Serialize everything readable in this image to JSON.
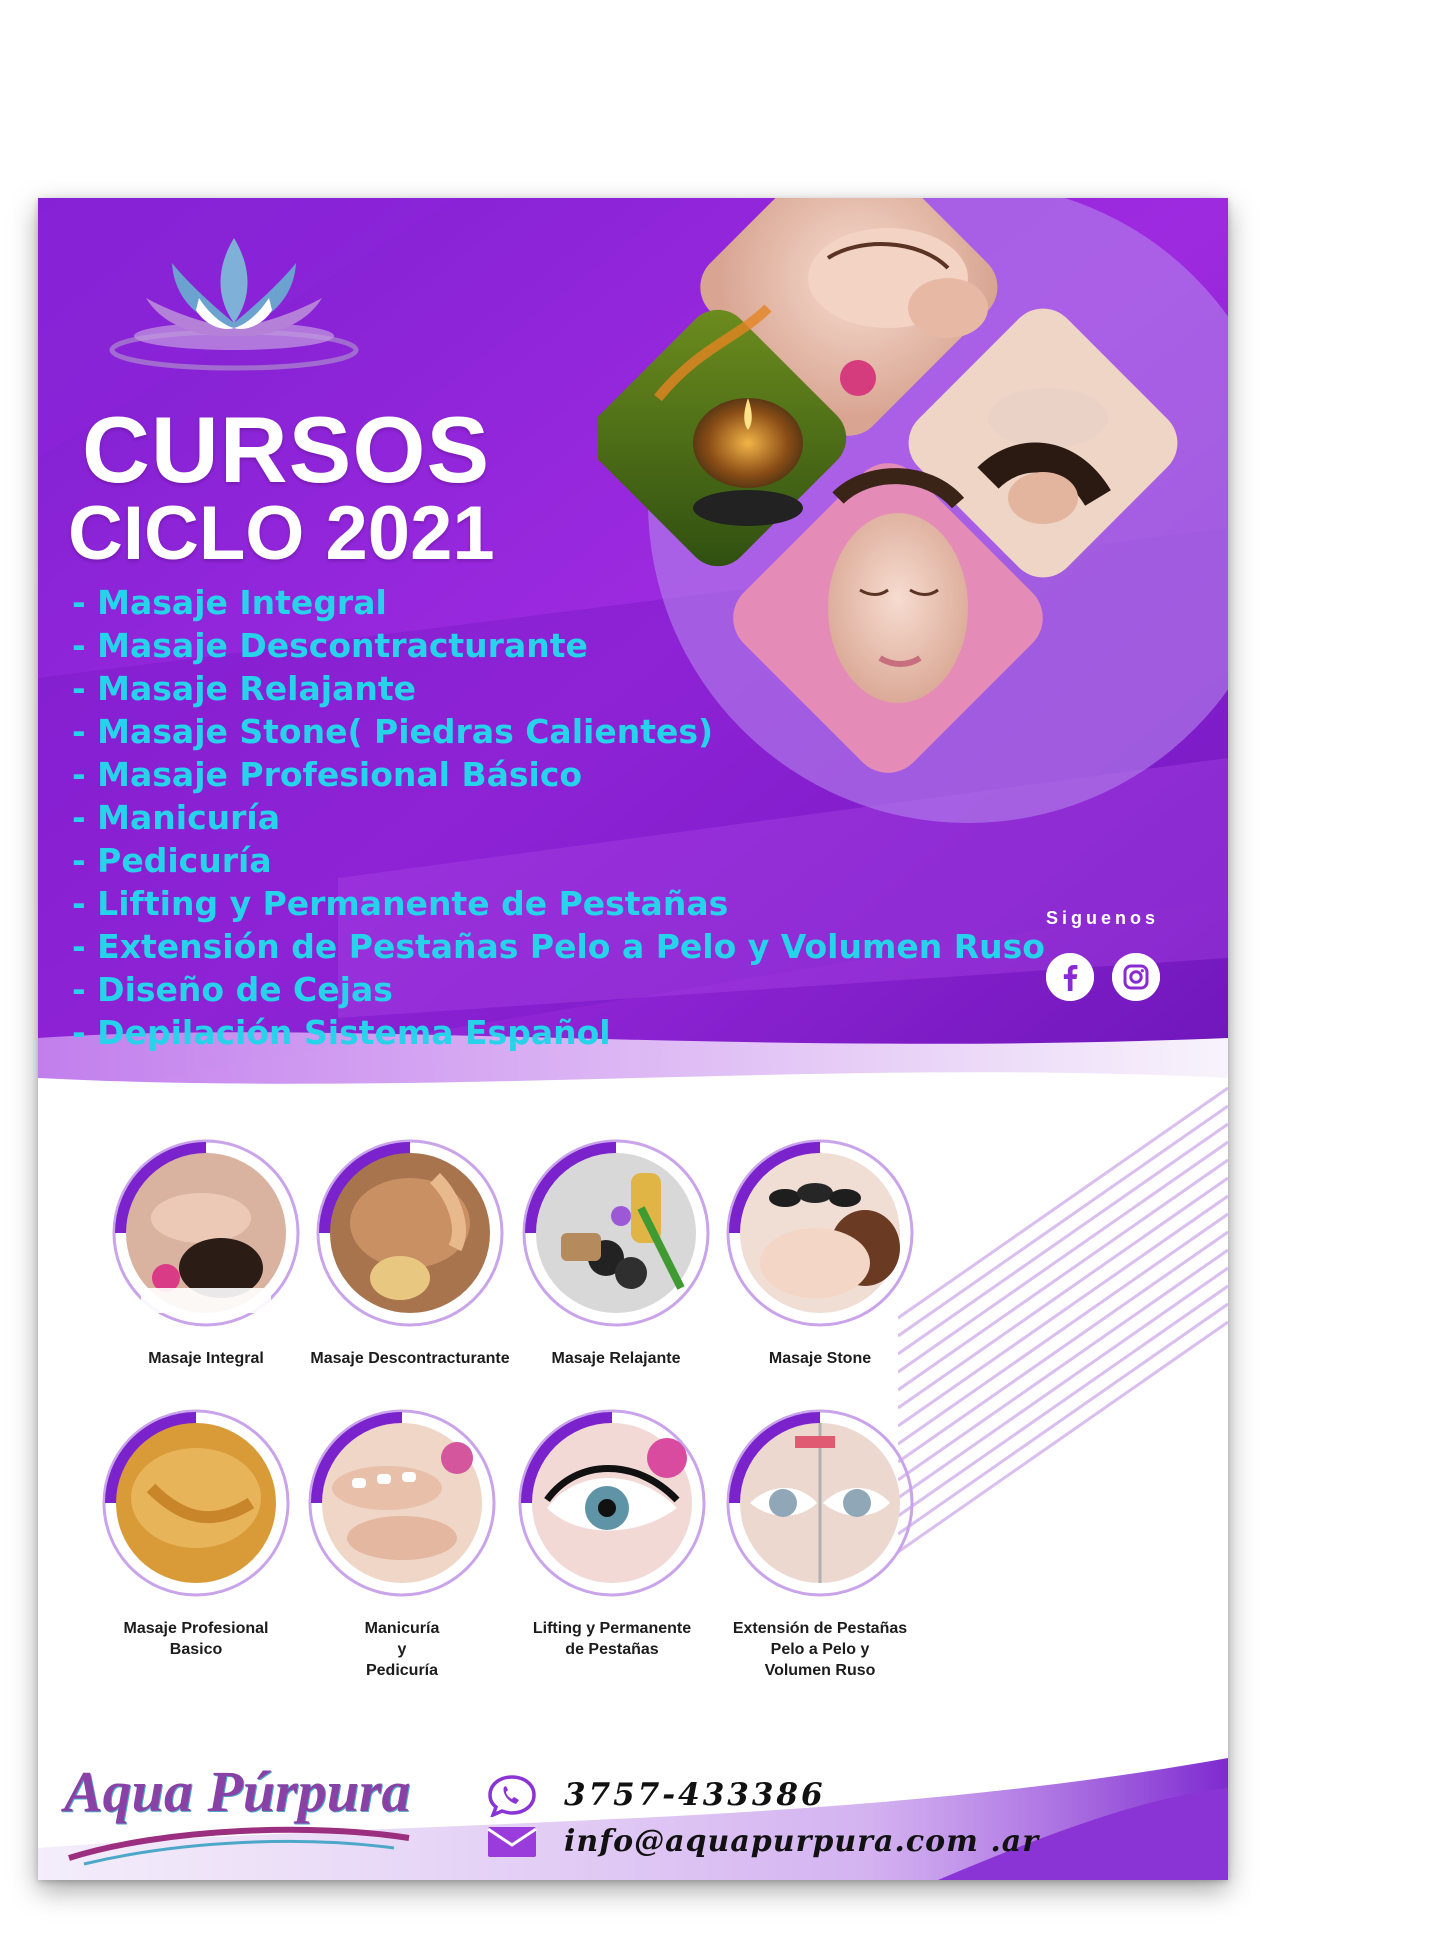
{
  "header": {
    "title": "CURSOS",
    "subtitle": "CICLO 2021"
  },
  "courses": [
    "- Masaje Integral",
    "- Masaje Descontracturante",
    "- Masaje Relajante",
    "- Masaje Stone( Piedras Calientes)",
    "- Masaje Profesional Básico",
    "- Manicuría",
    "- Pedicuría",
    "- Lifting y Permanente de Pestañas",
    "- Extensión de Pestañas Pelo a Pelo y Volumen Ruso",
    "- Diseño de Cejas",
    "- Depilación Sistema Español"
  ],
  "social": {
    "label": "Siguenos",
    "facebook_icon": "facebook-icon",
    "instagram_icon": "instagram-icon"
  },
  "services": [
    {
      "line1": "Masaje Integral",
      "line2": "",
      "line3": ""
    },
    {
      "line1": "Masaje Descontracturante",
      "line2": "",
      "line3": ""
    },
    {
      "line1": "Masaje Relajante",
      "line2": "",
      "line3": ""
    },
    {
      "line1": "Masaje Stone",
      "line2": "",
      "line3": ""
    },
    {
      "line1": "Masaje Profesional",
      "line2": "Basico",
      "line3": ""
    },
    {
      "line1": "Manicuría",
      "line2": "y",
      "line3": "Pedicuría"
    },
    {
      "line1": "Lifting y Permanente",
      "line2": "de Pestañas",
      "line3": ""
    },
    {
      "line1": "Extensión de Pestañas",
      "line2": "Pelo a Pelo y",
      "line3": "Volumen Ruso"
    }
  ],
  "brand": {
    "name": "Aqua Púrpura"
  },
  "contact": {
    "phone": "3757-433386",
    "email": "info@aquapurpura.com .ar",
    "phone_icon": "whatsapp-icon",
    "email_icon": "envelope-icon"
  },
  "colors": {
    "primary_purple": "#9a22d6",
    "dark_purple": "#6a16b4",
    "course_text": "#27d3ea",
    "white": "#ffffff"
  }
}
